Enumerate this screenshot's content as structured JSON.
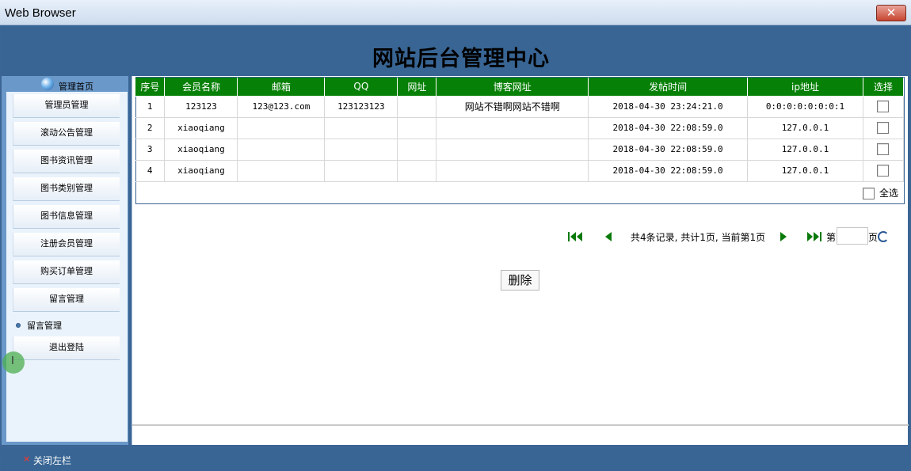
{
  "window": {
    "title": "Web Browser",
    "close_symbol": "✕"
  },
  "header": {
    "title": "网站后台管理中心"
  },
  "sidebar": {
    "home_label": "管理首页",
    "items": [
      {
        "label": "管理员管理"
      },
      {
        "label": "滚动公告管理"
      },
      {
        "label": "图书资讯管理"
      },
      {
        "label": "图书类别管理"
      },
      {
        "label": "图书信息管理"
      },
      {
        "label": "注册会员管理"
      },
      {
        "label": "购买订单管理"
      },
      {
        "label": "留言管理"
      }
    ],
    "sub_item": "留言管理",
    "logout_label": "退出登陆"
  },
  "table": {
    "columns": [
      "序号",
      "会员名称",
      "邮箱",
      "QQ",
      "网址",
      "博客网址",
      "发帖时间",
      "ip地址",
      "选择"
    ],
    "rows": [
      [
        "1",
        "123123",
        "123@123.com",
        "123123123",
        "",
        "网站不错啊网站不错啊",
        "2018-04-30 23:24:21.0",
        "0:0:0:0:0:0:0:1"
      ],
      [
        "2",
        "xiaoqiang",
        "",
        "",
        "",
        "",
        "2018-04-30 22:08:59.0",
        "127.0.0.1"
      ],
      [
        "3",
        "xiaoqiang",
        "",
        "",
        "",
        "",
        "2018-04-30 22:08:59.0",
        "127.0.0.1"
      ],
      [
        "4",
        "xiaoqiang",
        "",
        "",
        "",
        "",
        "2018-04-30 22:08:59.0",
        "127.0.0.1"
      ]
    ],
    "select_all_label": "全选"
  },
  "pager": {
    "summary": "共4条记录, 共计1页, 当前第1页",
    "page_prefix": "第",
    "page_suffix": "页",
    "page_value": ""
  },
  "actions": {
    "delete_label": "删除"
  },
  "footer": {
    "close_left_label": "关闭左栏",
    "close_symbol": "×"
  },
  "colors": {
    "header_blue": "#386593",
    "table_header_green": "#068006",
    "sidebar_blue": "#6a98c9"
  }
}
